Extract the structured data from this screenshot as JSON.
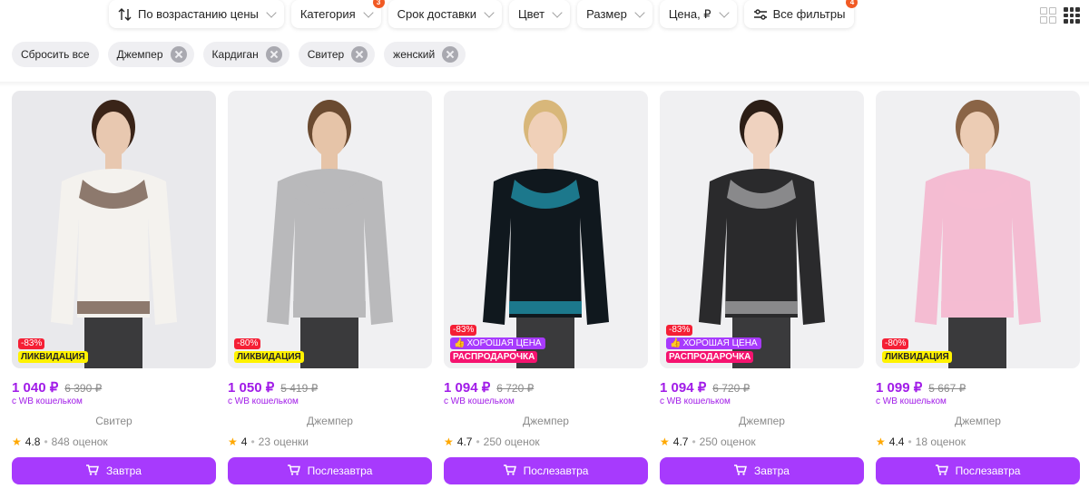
{
  "filters": {
    "sort": "По возрастанию цены",
    "category": "Категория",
    "category_badge": "3",
    "delivery": "Срок доставки",
    "color": "Цвет",
    "size": "Размер",
    "price": "Цена, ₽",
    "all_filters": "Все фильтры",
    "all_filters_badge": "4"
  },
  "chips": {
    "reset": "Сбросить все",
    "items": [
      "Джемпер",
      "Кардиган",
      "Свитер",
      "женский"
    ]
  },
  "colors": {
    "accent": "#a73afd",
    "price": "#a11ce8",
    "discount": "#f51f35",
    "liquidation": "#fff200",
    "sale": "#f5136f"
  },
  "products": [
    {
      "discount": "-83%",
      "tag": "ЛИКВИДАЦИЯ",
      "price": "1 040 ₽",
      "old_price": "6 390 ₽",
      "wallet": "с WB кошельком",
      "category": "Свитер",
      "rating": "4.8",
      "reviews": "848 оценок",
      "delivery": "Завтра",
      "sweater_color": "#f4f2ee",
      "pattern_color": "#7a6456",
      "skin": "#e8c8b0",
      "hair": "#3a2418"
    },
    {
      "discount": "-80%",
      "tag": "ЛИКВИДАЦИЯ",
      "price": "1 050 ₽",
      "old_price": "5 419 ₽",
      "wallet": "с WB кошельком",
      "category": "Джемпер",
      "rating": "4",
      "reviews": "23 оценки",
      "delivery": "Послезавтра",
      "sweater_color": "#b9b9bb",
      "pattern_color": "#b9b9bb",
      "skin": "#e6c4a8",
      "hair": "#6a4a30"
    },
    {
      "discount": "-83%",
      "tag_good": "ХОРОШАЯ ЦЕНА",
      "tag": "РАСПРОДАРОЧКА",
      "price": "1 094 ₽",
      "old_price": "6 720 ₽",
      "wallet": "с WB кошельком",
      "category": "Джемпер",
      "rating": "4.7",
      "reviews": "250 оценок",
      "delivery": "Послезавтра",
      "sweater_color": "#10181e",
      "pattern_color": "#1f8aa0",
      "skin": "#f0d0b8",
      "hair": "#d8b77a"
    },
    {
      "discount": "-83%",
      "tag_good": "ХОРОШАЯ ЦЕНА",
      "tag": "РАСПРОДАРОЧКА",
      "price": "1 094 ₽",
      "old_price": "6 720 ₽",
      "wallet": "с WB кошельком",
      "category": "Джемпер",
      "rating": "4.7",
      "reviews": "250 оценок",
      "delivery": "Завтра",
      "sweater_color": "#2a2a2c",
      "pattern_color": "#9a9a9c",
      "skin": "#efd2bf",
      "hair": "#2c1e16"
    },
    {
      "discount": "-80%",
      "tag": "ЛИКВИДАЦИЯ",
      "price": "1 099 ₽",
      "old_price": "5 667 ₽",
      "wallet": "с WB кошельком",
      "category": "Джемпер",
      "rating": "4.4",
      "reviews": "18 оценок",
      "delivery": "Послезавтра",
      "sweater_color": "#f4bcd2",
      "pattern_color": "#f4bcd2",
      "skin": "#ecccb4",
      "hair": "#8a6446"
    }
  ]
}
